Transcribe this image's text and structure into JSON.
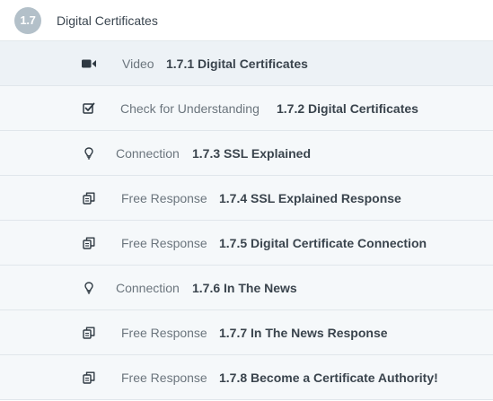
{
  "module": {
    "number": "1.7",
    "title": "Digital Certificates"
  },
  "items": [
    {
      "icon": "video-camera-icon",
      "type": "Video",
      "title": "1.7.1 Digital Certificates"
    },
    {
      "icon": "checkbox-icon",
      "type": "Check for Understanding",
      "title": "1.7.2 Digital Certificates"
    },
    {
      "icon": "lightbulb-icon",
      "type": "Connection",
      "title": "1.7.3 SSL Explained"
    },
    {
      "icon": "copy-document-icon",
      "type": "Free Response",
      "title": "1.7.4 SSL Explained Response"
    },
    {
      "icon": "copy-document-icon",
      "type": "Free Response",
      "title": "1.7.5 Digital Certificate Connection"
    },
    {
      "icon": "lightbulb-icon",
      "type": "Connection",
      "title": "1.7.6 In The News"
    },
    {
      "icon": "copy-document-icon",
      "type": "Free Response",
      "title": "1.7.7 In The News Response"
    },
    {
      "icon": "copy-document-icon",
      "type": "Free Response",
      "title": "1.7.8 Become a Certificate Authority!"
    }
  ]
}
